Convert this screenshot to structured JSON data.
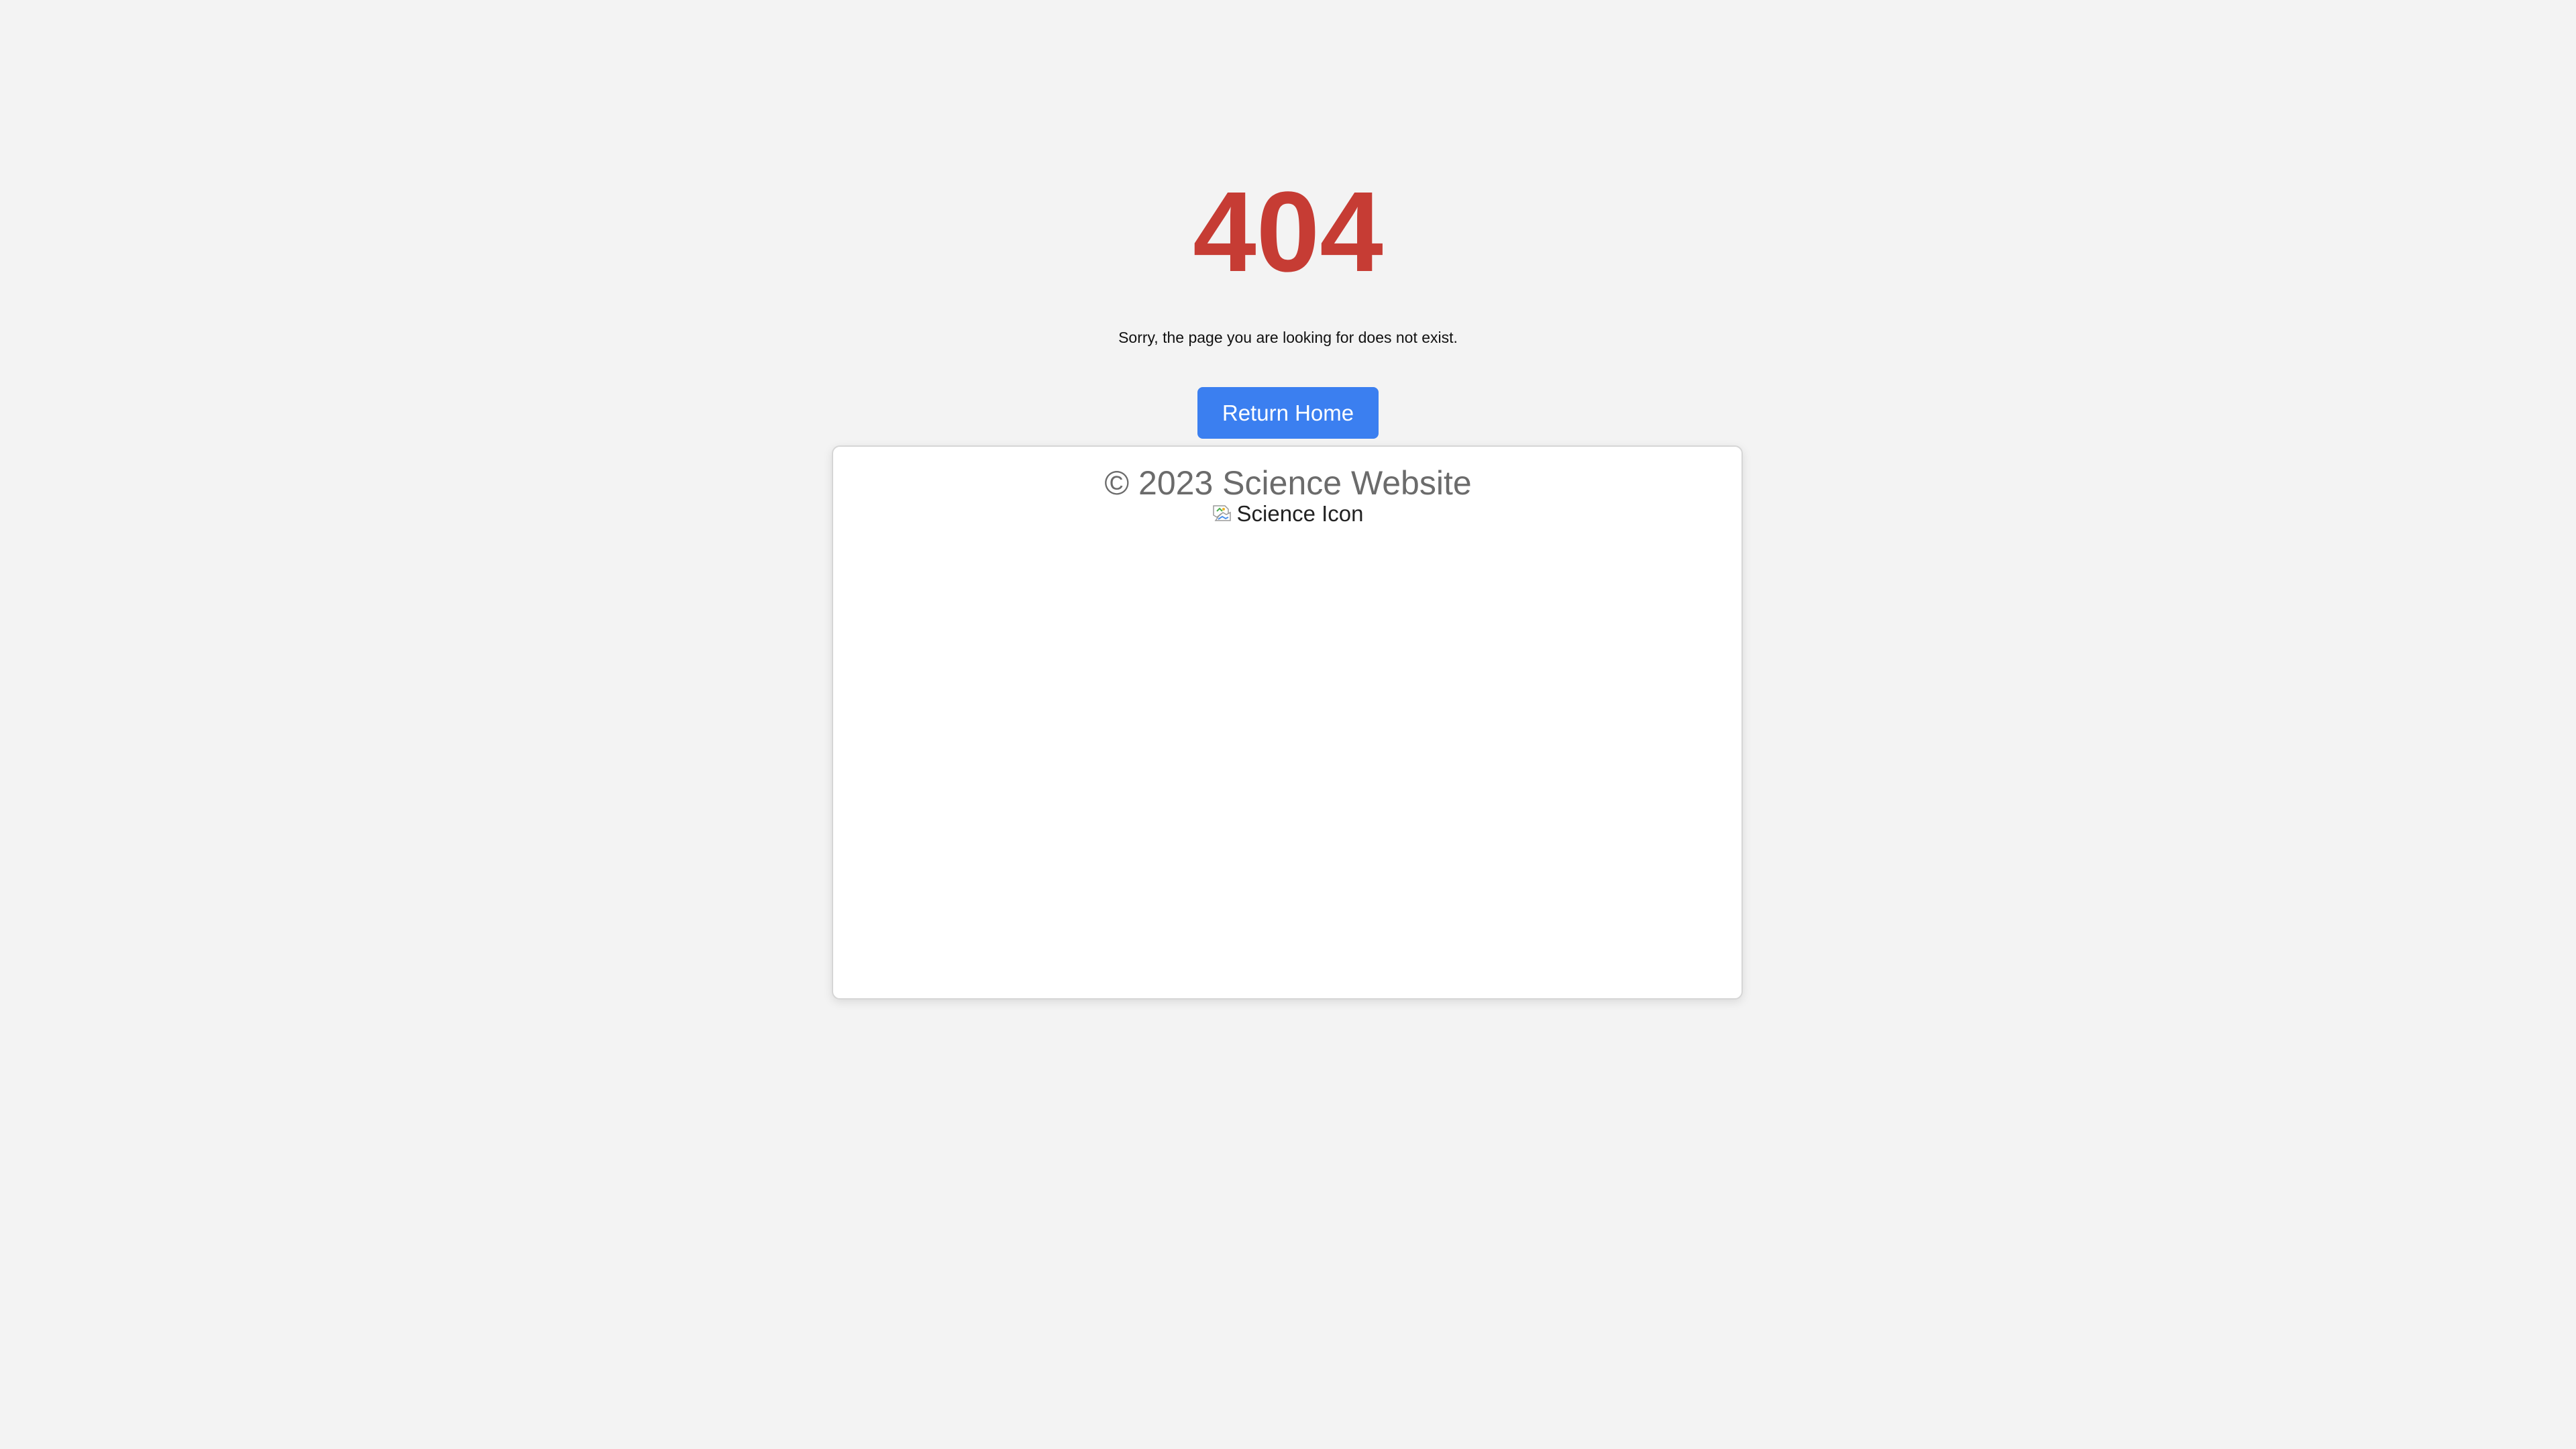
{
  "image": {
    "alt": "Science Icon",
    "icon": "broken-image-icon"
  },
  "error": {
    "code": "404",
    "message": "Sorry, the page you are looking for does not exist."
  },
  "actions": {
    "return_home_label": "Return Home"
  },
  "footer": {
    "text": "© 2023 Science Website"
  },
  "colors": {
    "background": "#f3f3f3",
    "card": "#ffffff",
    "error_code": "#c63c34",
    "button": "#3b7ff0",
    "footer_text": "#6b6b6b"
  }
}
